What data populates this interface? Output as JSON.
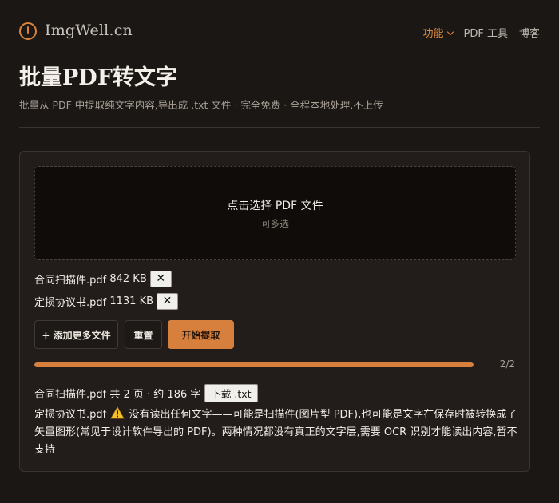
{
  "brand": {
    "name": "ImgWell.cn"
  },
  "nav": {
    "items": [
      {
        "label": "功能",
        "active": true
      },
      {
        "label": "PDF 工具"
      },
      {
        "label": "博客"
      }
    ]
  },
  "page": {
    "title": "批量PDF转文字",
    "subtitle": "批量从 PDF 中提取纯文字内容,导出成 .txt 文件 · 完全免费 · 全程本地处理,不上传"
  },
  "dropzone": {
    "title": "点击选择 PDF 文件",
    "hint": "可多选"
  },
  "files": [
    {
      "name": "合同扫描件.pdf",
      "size": "842 KB",
      "remove_label": "✕"
    },
    {
      "name": "定损协议书.pdf",
      "size": "1131 KB",
      "remove_label": "✕"
    }
  ],
  "buttons": {
    "add_more": "+ 添加更多文件",
    "reset": "重置",
    "start": "开始提取"
  },
  "progress": {
    "fraction": 1.0,
    "label": "2/2"
  },
  "results": [
    {
      "name": "合同扫描件.pdf",
      "summary": "共 2 页 · 约 186 字",
      "download_label": "下载 .txt"
    }
  ],
  "warning": {
    "name": "定损协议书.pdf",
    "icon": "warning-icon",
    "message": "没有读出任何文字——可能是扫描件(图片型 PDF),也可能是文字在保存时被转换成了矢量图形(常见于设计软件导出的 PDF)。两种情况都没有真正的文字层,需要 OCR 识别才能读出内容,暂不支持"
  },
  "colors": {
    "accent": "#d77f3c",
    "background": "#1b1715",
    "card": "#221d1a"
  }
}
